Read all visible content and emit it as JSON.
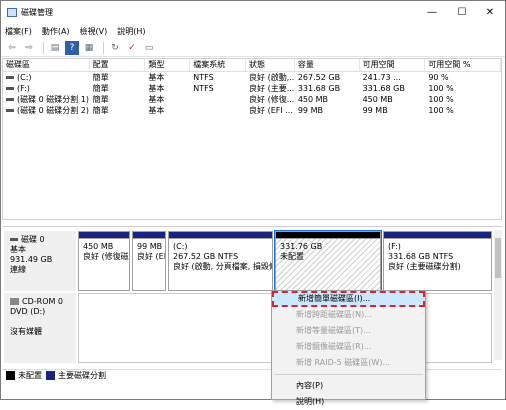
{
  "window": {
    "title": "磁碟管理",
    "controls": {
      "minimize": "—",
      "maximize": "☐",
      "close": "✕"
    }
  },
  "menu": [
    "檔案(F)",
    "動作(A)",
    "檢視(V)",
    "說明(H)"
  ],
  "toolbar": {
    "icons": [
      "back-arrow-icon",
      "forward-arrow-icon",
      "console-icon",
      "help-icon",
      "properties-icon",
      "refresh-icon",
      "view-icon"
    ],
    "glyphs": {
      "back": "⇦",
      "forward": "⇨",
      "console": "▤",
      "help": "?",
      "properties": "▦",
      "refresh": "↻",
      "view": "▭"
    }
  },
  "volumes": {
    "headers": [
      "磁碟區",
      "配置",
      "類型",
      "檔案系統",
      "狀態",
      "容量",
      "可用空間",
      "可用空間 %"
    ],
    "rows": [
      [
        "(C:)",
        "簡單",
        "基本",
        "NTFS",
        "良好 (啟動,...",
        "267.52 GB",
        "241.73 ...",
        "90 %"
      ],
      [
        "(F:)",
        "簡單",
        "基本",
        "NTFS",
        "良好 (主要...",
        "331.68 GB",
        "331.68 GB",
        "100 %"
      ],
      [
        "(磁碟 0 磁碟分割 1)",
        "簡單",
        "基本",
        "",
        "良好 (修復...",
        "450 MB",
        "450 MB",
        "100 %"
      ],
      [
        "(磁碟 0 磁碟分割 2)",
        "簡單",
        "基本",
        "",
        "良好 (EFI ...",
        "99 MB",
        "99 MB",
        "100 %"
      ]
    ]
  },
  "disk0": {
    "name": "磁碟 0",
    "type": "基本",
    "size": "931.49 GB",
    "status": "連線",
    "partitions": [
      {
        "line1": "",
        "line2": "450 MB",
        "line3": "良好 (修復磁"
      },
      {
        "line1": "",
        "line2": "99 MB",
        "line3": "良好 (EF"
      },
      {
        "line1": "(C:)",
        "line2": "267.52 GB NTFS",
        "line3": "良好 (啟動, 分頁檔案, 損毀傾"
      },
      {
        "line1": "",
        "line2": "331.76 GB",
        "line3": "未配置"
      },
      {
        "line1": "(F:)",
        "line2": "331.68 GB NTFS",
        "line3": "良好 (主要磁碟分割)"
      }
    ]
  },
  "cdrom": {
    "name": "CD-ROM 0",
    "type": "DVD (D:)",
    "status": "沒有媒體"
  },
  "legend": [
    {
      "label": "未配置",
      "color": "#000000"
    },
    {
      "label": "主要磁碟分割",
      "color": "#1a237e"
    }
  ],
  "context_menu": {
    "items": [
      {
        "label": "新增簡單磁碟區(I)...",
        "enabled": true
      },
      {
        "label": "新增跨距磁碟區(N)...",
        "enabled": false
      },
      {
        "label": "新增等量磁碟區(T)...",
        "enabled": false
      },
      {
        "label": "新增鏡像磁碟區(R)...",
        "enabled": false
      },
      {
        "label": "新增 RAID-5 磁碟區(W)...",
        "enabled": false
      },
      {
        "label": "內容(P)",
        "enabled": true
      },
      {
        "label": "說明(H)",
        "enabled": true
      }
    ]
  }
}
